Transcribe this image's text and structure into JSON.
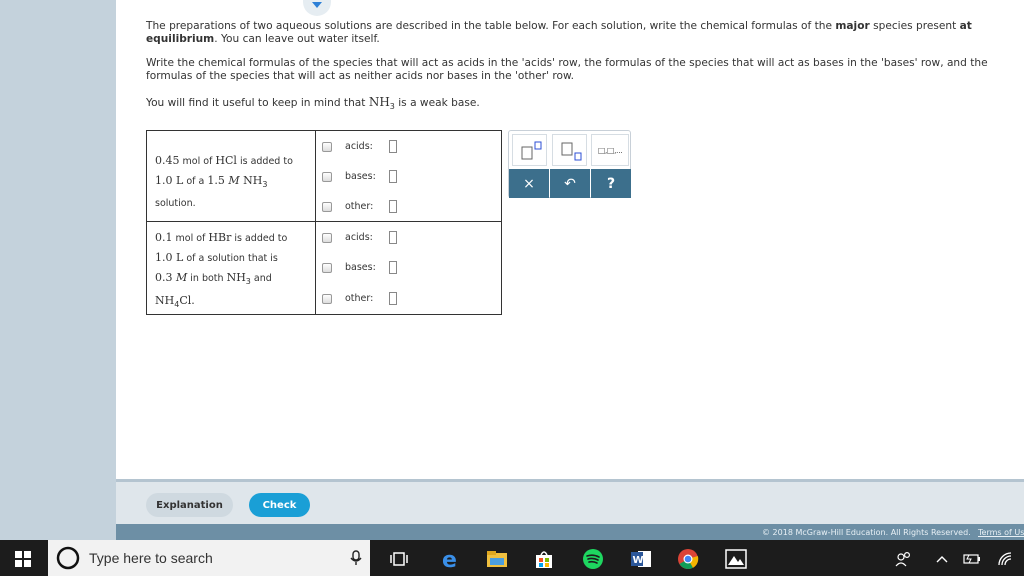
{
  "question": {
    "intro_a": "The preparations of two aqueous solutions are described in the table below. For each solution, write the chemical formulas of the ",
    "intro_bold1": "major",
    "intro_b": " species present ",
    "intro_bold2": "at",
    "intro_bold3": "equilibrium",
    "intro_c": ". You can leave out water itself.",
    "instr_line1": "Write the chemical formulas of the species that will act as acids in the 'acids' row, the formulas of the species that will act as bases in the 'bases' row, and the",
    "instr_line2": "formulas of the species that will act as neither acids nor bases in the 'other' row.",
    "hint_prefix": "You will find it useful to keep in mind that ",
    "hint_formula": "NH",
    "hint_sub": "3",
    "hint_suffix": " is a weak base."
  },
  "table": {
    "row1": {
      "l1_num": "0.45",
      "l1_a": " mol of ",
      "l1_formula": "HCl",
      "l1_b": " is added to",
      "l2_num": "1.0 L",
      "l2_a": " of a ",
      "l2_conc": "1.5 ",
      "l2_M": "M",
      "l2_formula": " NH",
      "l2_sub": "3",
      "l3": "solution."
    },
    "row2": {
      "l1_num": "0.1",
      "l1_a": " mol of ",
      "l1_formula": "HBr",
      "l1_b": " is added to",
      "l2_num": "1.0 L",
      "l2_a": " of a solution that is",
      "l3_num": "0.3 ",
      "l3_M": "M",
      "l3_a": " in both ",
      "l3_formula": "NH",
      "l3_sub": "3",
      "l3_b": " and",
      "l4_formula": "NH",
      "l4_sub": "4",
      "l4_rest": "Cl."
    },
    "options": {
      "acids": "acids:",
      "bases": "bases:",
      "other": "other:"
    }
  },
  "palette": {
    "clear": "×",
    "undo": "↶",
    "help": "?",
    "dots": "□,□,..."
  },
  "footer": {
    "explanation": "Explanation",
    "check": "Check",
    "copyright": "© 2018 McGraw-Hill Education. All Rights Reserved.",
    "terms": "Terms of Us"
  },
  "taskbar": {
    "search_placeholder": "Type here to search"
  },
  "colors": {
    "check_button": "#1a9fd6",
    "accent_blue": "#2c7fd6",
    "palette_action": "#3c6f8c"
  }
}
